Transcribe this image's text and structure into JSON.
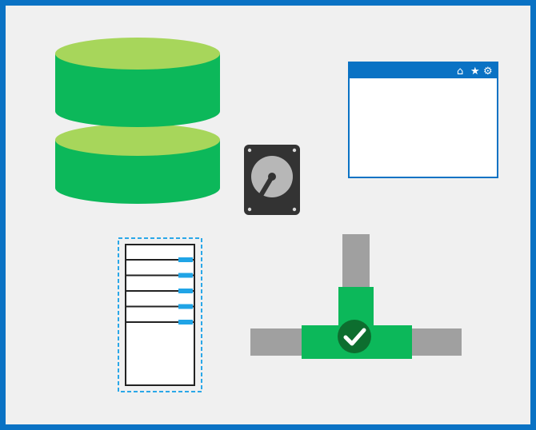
{
  "colors": {
    "frame": "#0a72c4",
    "background": "#f0f0f0",
    "database_body": "#0cb85a",
    "database_top": "#a7d65b",
    "disk_body": "#333333",
    "disk_platter": "#b7b7b7",
    "disk_screw": "#d9d9d9",
    "browser_titlebar": "#0a72c4",
    "browser_icons": "#ffffff",
    "browser_content": "#ffffff",
    "server_border": "#2aa7e8",
    "server_frame": "#222222",
    "server_led": "#20a4e6",
    "pipe_gray": "#a0a0a0",
    "pipe_green": "#0cb85a",
    "check_circle": "#0d6e2f",
    "check_mark": "#ffffff"
  },
  "icons": {
    "database": "database-icon",
    "hard_disk": "hard-disk-icon",
    "browser": "browser-window-icon",
    "browser_home": "home-icon",
    "browser_star": "star-icon",
    "browser_settings": "gear-icon",
    "server": "server-rack-icon",
    "pipe": "pipe-tee-icon",
    "check": "check-circle-icon"
  },
  "browser": {
    "toolbar_glyphs": [
      "⌂",
      "★",
      "⚙"
    ]
  },
  "server": {
    "drive_count": 5
  }
}
